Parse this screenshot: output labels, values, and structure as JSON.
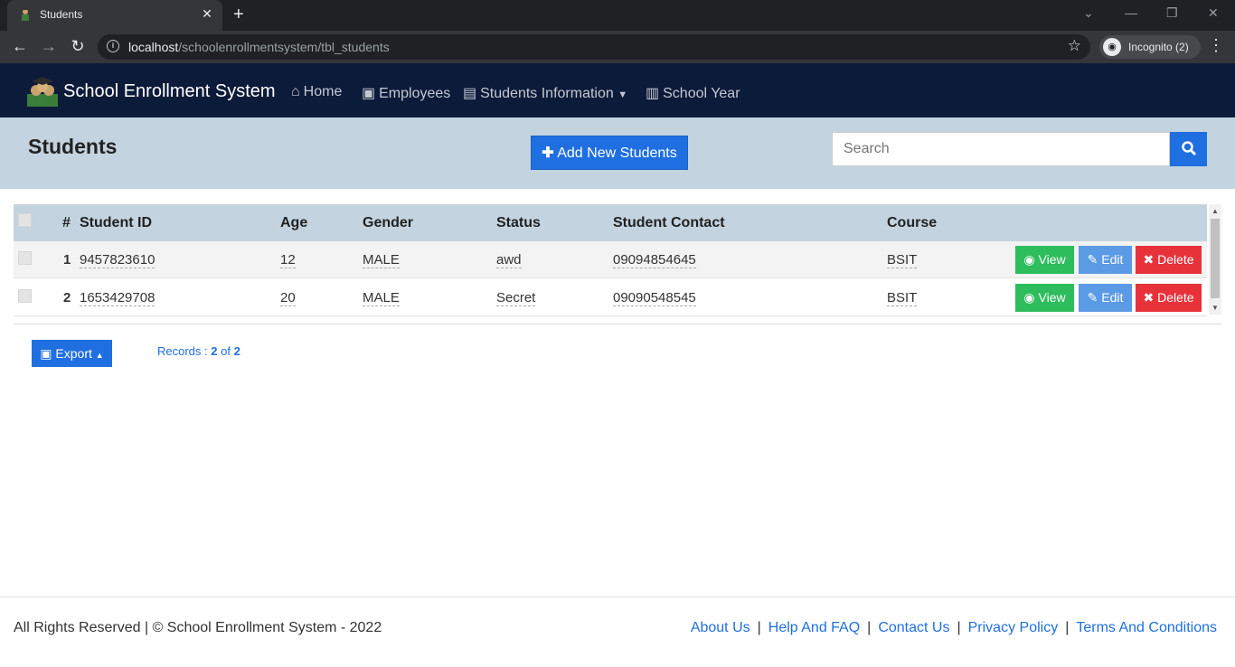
{
  "browser": {
    "tab_title": "Students",
    "tab_close": "✕",
    "new_tab": "+",
    "url_host": "localhost",
    "url_path": "/schoolenrollmentsystem/tbl_students",
    "incognito_label": "Incognito (2)"
  },
  "navbar": {
    "brand": "School Enrollment System",
    "links": [
      {
        "label": "Home",
        "icon": "home-icon"
      },
      {
        "label": "Employees",
        "icon": "briefcase-icon"
      },
      {
        "label": "Students Information",
        "icon": "book-icon"
      },
      {
        "label": "School Year",
        "icon": "building-icon"
      }
    ]
  },
  "header": {
    "title": "Students",
    "add_button": "Add New Students",
    "search_placeholder": "Search"
  },
  "table": {
    "columns": [
      "#",
      "Student ID",
      "Age",
      "Gender",
      "Status",
      "Student Contact",
      "Course"
    ],
    "rows": [
      {
        "num": "1",
        "student_id": "9457823610",
        "age": "12",
        "gender": "MALE",
        "status": "awd",
        "contact": "09094854645",
        "course": "BSIT"
      },
      {
        "num": "2",
        "student_id": "1653429708",
        "age": "20",
        "gender": "MALE",
        "status": "Secret",
        "contact": "09090548545",
        "course": "BSIT"
      }
    ],
    "actions": {
      "view": "View",
      "edit": "Edit",
      "delete": "Delete"
    }
  },
  "footer_bar": {
    "export_label": "Export",
    "records_prefix": "Records : ",
    "records_count": "2",
    "records_of": " of ",
    "records_total": "2"
  },
  "footer": {
    "copyright": "All Rights Reserved | © School Enrollment System - 2022",
    "links": [
      "About Us",
      "Help And FAQ",
      "Contact Us",
      "Privacy Policy",
      "Terms And Conditions"
    ]
  },
  "colors": {
    "navbar": "#0d1b3a",
    "header_band": "#c3d3df",
    "primary": "#1f6fe0",
    "view": "#2ebd5c",
    "edit": "#5b9ae5",
    "delete": "#e8323a"
  }
}
